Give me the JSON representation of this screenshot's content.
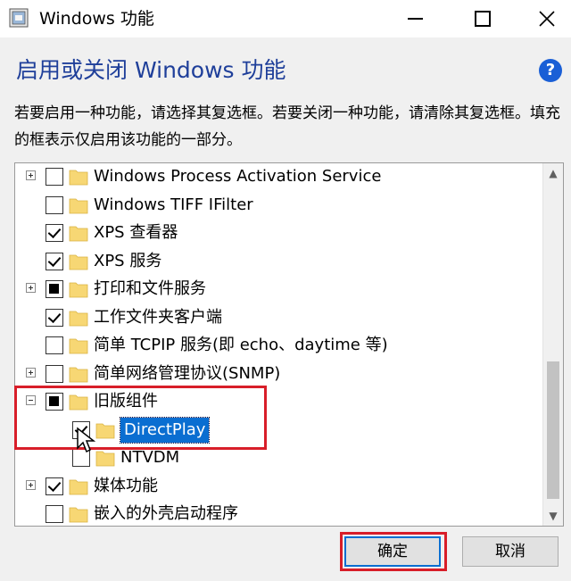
{
  "window": {
    "title": "Windows 功能",
    "heading": "启用或关闭 Windows 功能",
    "help_symbol": "?",
    "description": "若要启用一种功能，请选择其复选框。若要关闭一种功能，请清除其复选框。填充的框表示仅启用该功能的一部分。"
  },
  "features": [
    {
      "label": "Windows Process Activation Service",
      "state": "unchecked",
      "expandable": "plus",
      "level": 0
    },
    {
      "label": "Windows TIFF IFilter",
      "state": "unchecked",
      "expandable": "none",
      "level": 0
    },
    {
      "label": "XPS 查看器",
      "state": "checked",
      "expandable": "none",
      "level": 0
    },
    {
      "label": "XPS 服务",
      "state": "checked",
      "expandable": "none",
      "level": 0
    },
    {
      "label": "打印和文件服务",
      "state": "partial",
      "expandable": "plus",
      "level": 0
    },
    {
      "label": "工作文件夹客户端",
      "state": "checked",
      "expandable": "none",
      "level": 0
    },
    {
      "label": "简单 TCPIP 服务(即 echo、daytime 等)",
      "state": "unchecked",
      "expandable": "none",
      "level": 0
    },
    {
      "label": "简单网络管理协议(SNMP)",
      "state": "unchecked",
      "expandable": "plus",
      "level": 0
    },
    {
      "label": "旧版组件",
      "state": "partial",
      "expandable": "minus",
      "level": 0
    },
    {
      "label": "DirectPlay",
      "state": "checked",
      "expandable": "none",
      "level": 1,
      "selected": true
    },
    {
      "label": "NTVDM",
      "state": "unchecked",
      "expandable": "none",
      "level": 1
    },
    {
      "label": "媒体功能",
      "state": "checked",
      "expandable": "plus",
      "level": 0
    },
    {
      "label": "嵌入的外壳启动程序",
      "state": "unchecked",
      "expandable": "none",
      "level": 0
    }
  ],
  "buttons": {
    "ok": "确定",
    "cancel": "取消"
  },
  "colors": {
    "heading": "#1f3f9a",
    "selection": "#0a6ed1",
    "highlight_box": "#d81e29",
    "folder": "#f7d774"
  }
}
